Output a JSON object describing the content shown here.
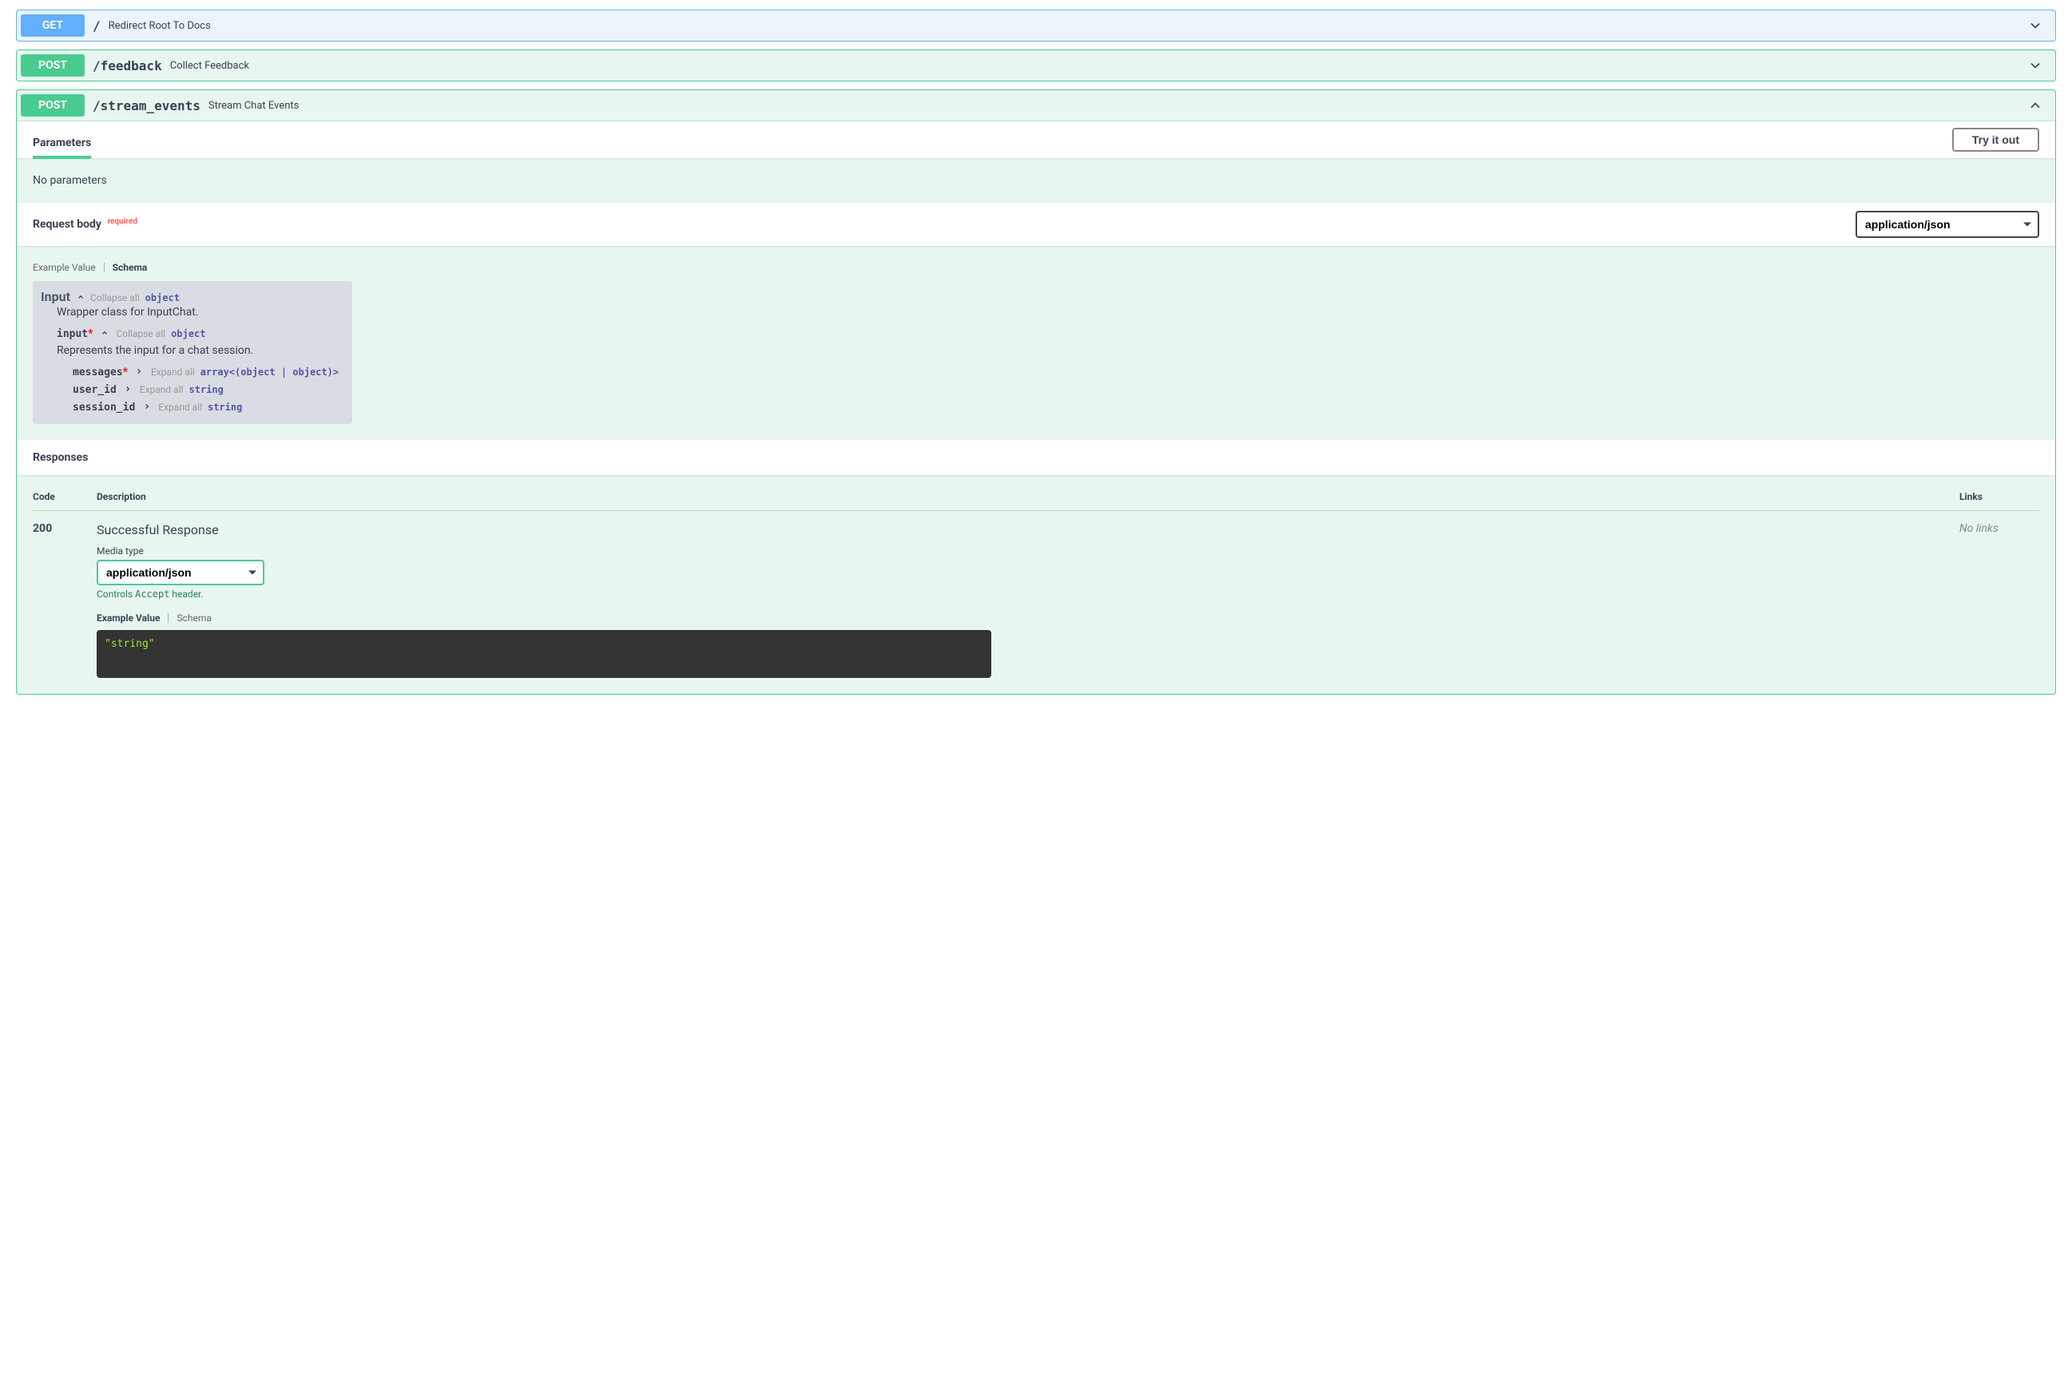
{
  "endpoints": [
    {
      "method": "GET",
      "path": "/",
      "desc": "Redirect Root To Docs",
      "expanded": false
    },
    {
      "method": "POST",
      "path": "/feedback",
      "desc": "Collect Feedback",
      "expanded": false
    },
    {
      "method": "POST",
      "path": "/stream_events",
      "desc": "Stream Chat Events",
      "expanded": true
    }
  ],
  "parameters": {
    "title": "Parameters",
    "try_it": "Try it out",
    "empty": "No parameters"
  },
  "request_body": {
    "title": "Request body",
    "required": "required",
    "content_type": "application/json",
    "tabs": {
      "example": "Example Value",
      "schema": "Schema"
    },
    "model": {
      "name": "Input",
      "collapse_hint": "Collapse all",
      "type": "object",
      "desc": "Wrapper class for InputChat.",
      "props": [
        {
          "name": "input",
          "required": true,
          "collapsed": false,
          "collapse_hint": "Collapse all",
          "type": "object",
          "desc": "Represents the input for a chat session.",
          "children": [
            {
              "name": "messages",
              "required": true,
              "expand_hint": "Expand all",
              "type": "array<(object | object)>"
            },
            {
              "name": "user_id",
              "required": false,
              "expand_hint": "Expand all",
              "type": "string"
            },
            {
              "name": "session_id",
              "required": false,
              "expand_hint": "Expand all",
              "type": "string"
            }
          ]
        }
      ]
    }
  },
  "responses": {
    "title": "Responses",
    "headers": {
      "code": "Code",
      "desc": "Description",
      "links": "Links"
    },
    "rows": [
      {
        "code": "200",
        "desc": "Successful Response",
        "media_label": "Media type",
        "media_type": "application/json",
        "accept_hint_pre": "Controls ",
        "accept_hint_code": "Accept",
        "accept_hint_post": " header.",
        "tabs": {
          "example": "Example Value",
          "schema": "Schema"
        },
        "example": "\"string\"",
        "links": "No links"
      }
    ]
  }
}
